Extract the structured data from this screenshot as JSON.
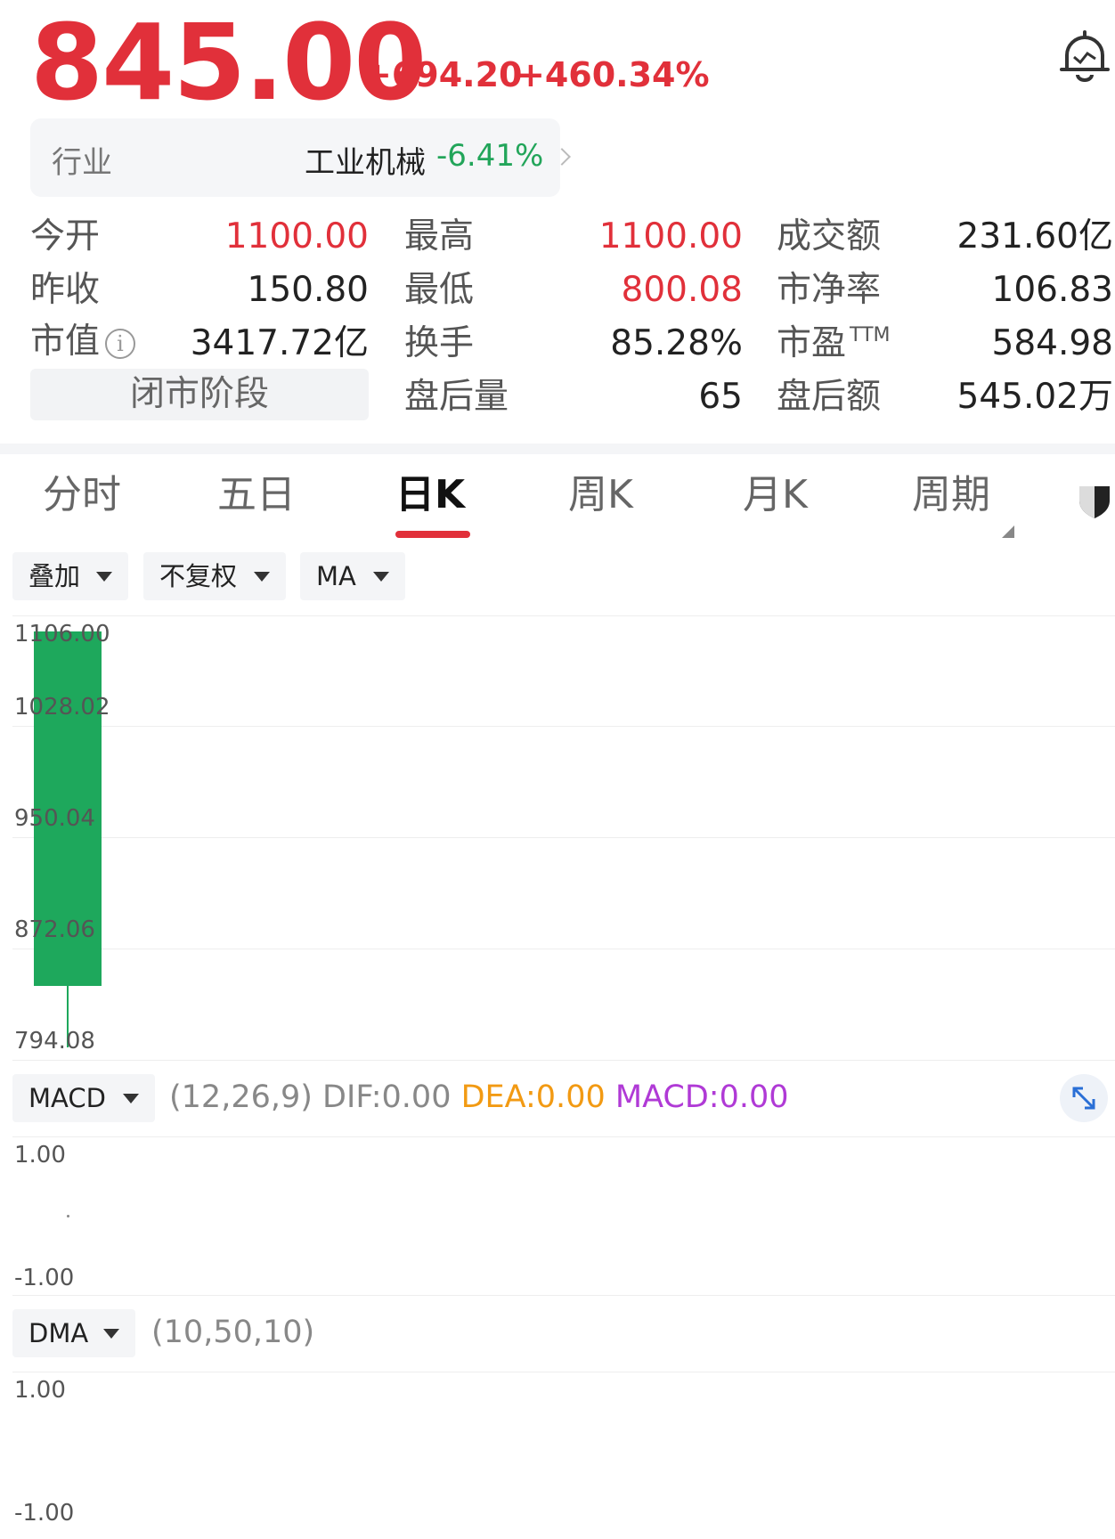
{
  "quote": {
    "price": "845.00",
    "change": "+694.20",
    "change_pct": "+460.34%"
  },
  "industry": {
    "label": "行业",
    "name": "工业机械",
    "pct": "-6.41%"
  },
  "stats": {
    "open_label": "今开",
    "open": "1100.00",
    "high_label": "最高",
    "high": "1100.00",
    "turnover_amt_label": "成交额",
    "turnover_amt": "231.60亿",
    "prev_close_label": "昨收",
    "prev_close": "150.80",
    "low_label": "最低",
    "low": "800.08",
    "pb_label": "市净率",
    "pb": "106.83",
    "mkt_cap_label": "市值",
    "mkt_cap": "3417.72亿",
    "turnover_rate_label": "换手",
    "turnover_rate": "85.28%",
    "pe_label": "市盈",
    "pe_sup": "TTM",
    "pe": "584.98",
    "phase": "闭市阶段",
    "after_vol_label": "盘后量",
    "after_vol": "65",
    "after_amt_label": "盘后额",
    "after_amt": "545.02万"
  },
  "tabs": [
    "分时",
    "五日",
    "日K",
    "周K",
    "月K",
    "周期"
  ],
  "active_tab": "日K",
  "toolbar": {
    "overlay": "叠加",
    "adjust": "不复权",
    "ma": "MA"
  },
  "chart_data": {
    "type": "candlestick",
    "y_ticks": [
      "1106.00",
      "1028.02",
      "950.04",
      "872.06",
      "794.08"
    ],
    "ylim": [
      794.08,
      1106.0
    ],
    "candles": [
      {
        "open": 1100.0,
        "high": 1100.0,
        "low": 800.08,
        "close": 845.0
      }
    ]
  },
  "macd": {
    "name": "MACD",
    "params": "(12,26,9)",
    "dif": "DIF:0.00",
    "dea": "DEA:0.00",
    "macd": "MACD:0.00",
    "y_top": "1.00",
    "y_bottom": "-1.00"
  },
  "dma": {
    "name": "DMA",
    "params": "(10,50,10)",
    "y_top": "1.00",
    "y_bottom": "-1.00"
  },
  "colors": {
    "up": "#e1303a",
    "down": "#1ea85c",
    "industry_down": "#22a55a",
    "dea": "#f29a13",
    "macd": "#b03ad6"
  }
}
